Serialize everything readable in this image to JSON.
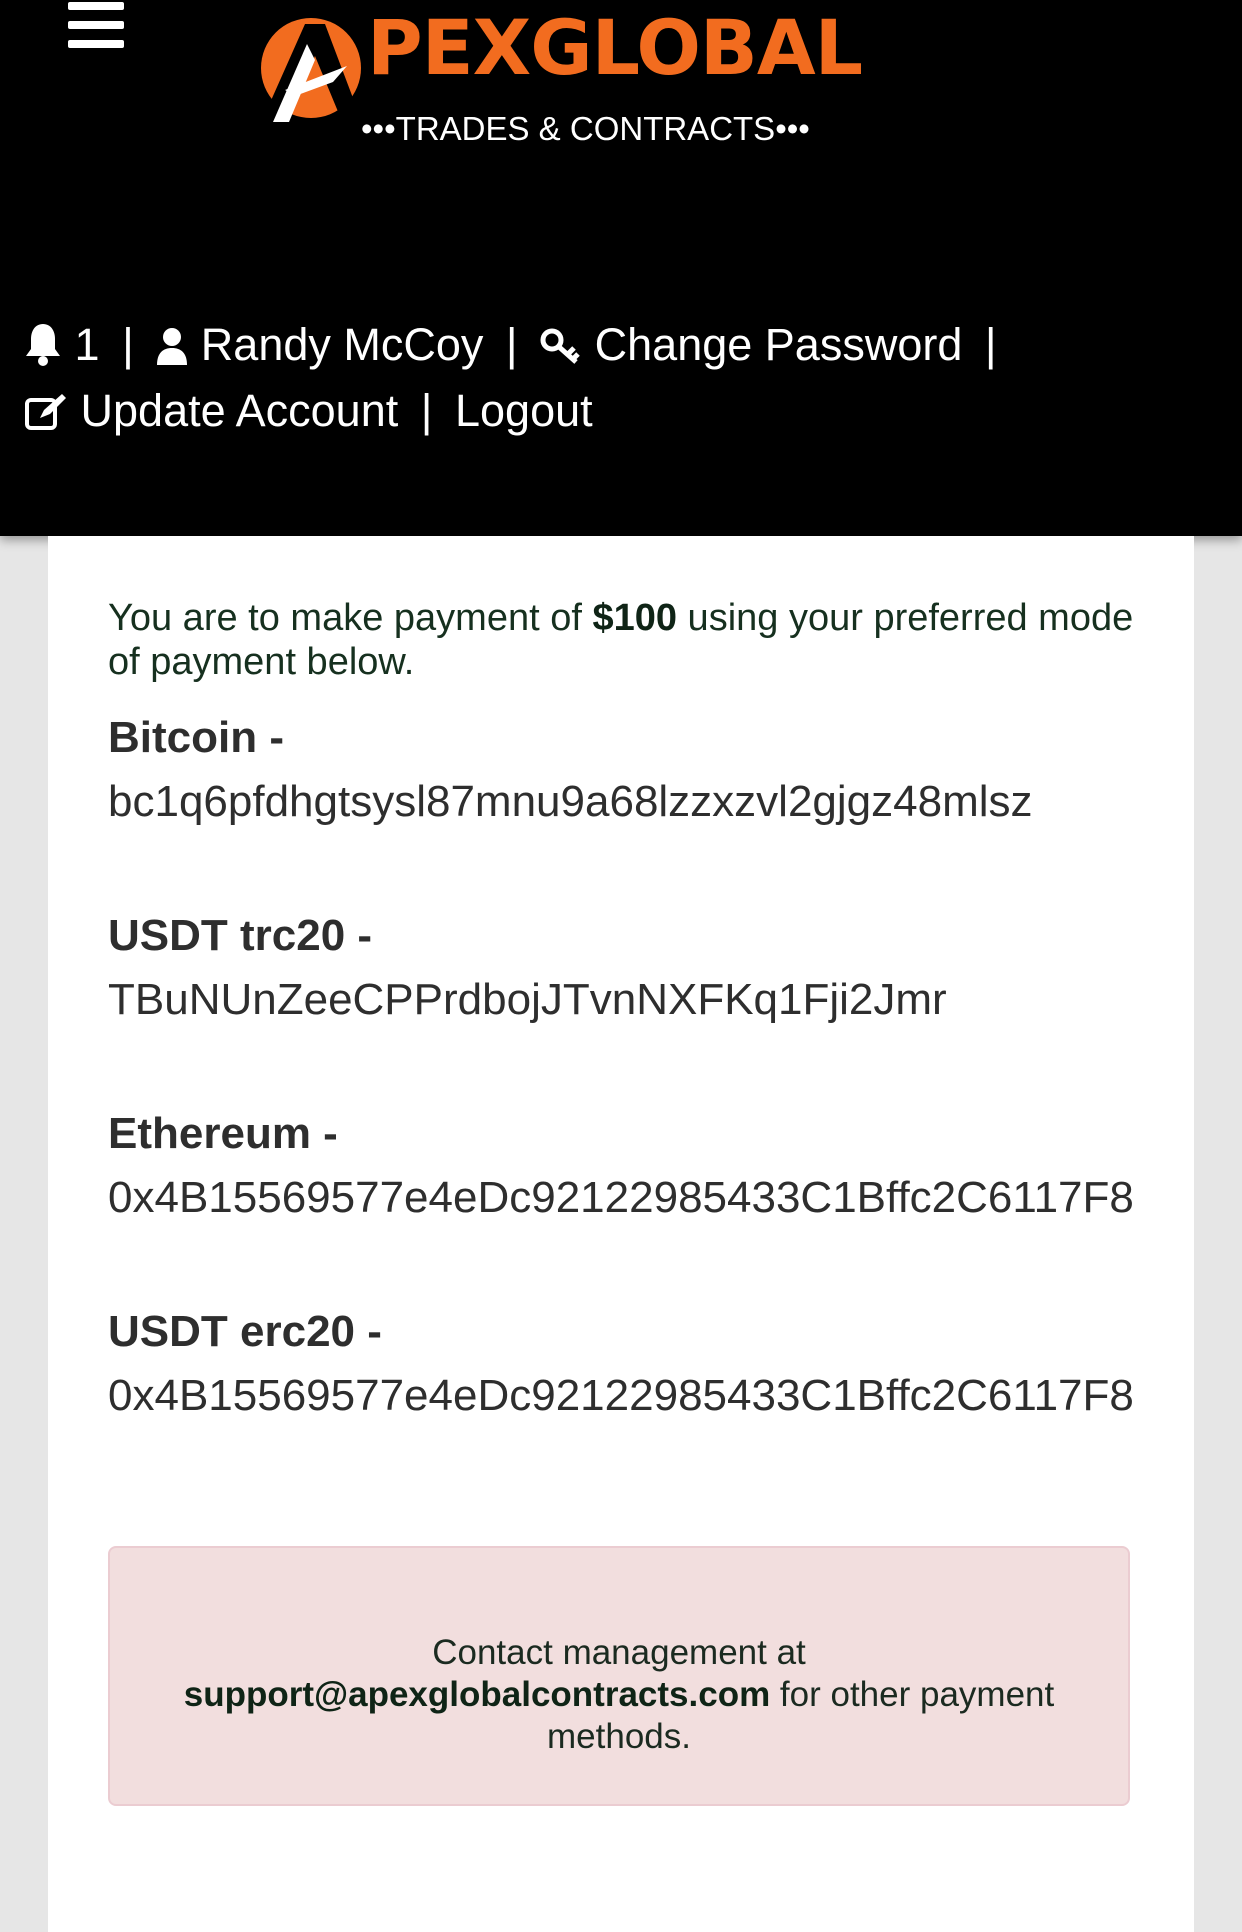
{
  "header": {
    "logo": {
      "brand": "PEXGLOBAL",
      "tagline": "•••TRADES & CONTRACTS•••"
    },
    "nav": {
      "notification_count": "1",
      "user_name": "Randy McCoy",
      "change_password": "Change Password",
      "update_account": "Update Account",
      "logout": "Logout",
      "separator": "|"
    }
  },
  "payment": {
    "intro_before": "You are to make payment of ",
    "amount": "$100",
    "intro_after": " using your preferred mode of payment below.",
    "methods": [
      {
        "name": "Bitcoin -",
        "address": "bc1q6pfdhgtsysl87mnu9a68lzzxzvl2gjgz48mlsz"
      },
      {
        "name": "USDT trc20 -",
        "address": "TBuNUnZeeCPPrdbojJTvnNXFKq1Fji2Jmr"
      },
      {
        "name": "Ethereum -",
        "address": "0x4B15569577e4eDc92122985433C1Bffc2C6117F8"
      },
      {
        "name": "USDT erc20 -",
        "address": "0x4B15569577e4eDc92122985433C1Bffc2C6117F8"
      }
    ],
    "contact": {
      "line1": "Contact management at",
      "email": "support@apexglobalcontracts.com",
      "line2": " for other payment methods."
    }
  },
  "colors": {
    "header_bg": "#000000",
    "brand_orange": "#f26c1f",
    "alert_bg": "#f2dede",
    "alert_border": "#ebccd1",
    "page_bg": "#e6e6e6"
  },
  "icons": [
    "menu-icon",
    "bell-icon",
    "user-icon",
    "key-icon",
    "edit-icon"
  ]
}
